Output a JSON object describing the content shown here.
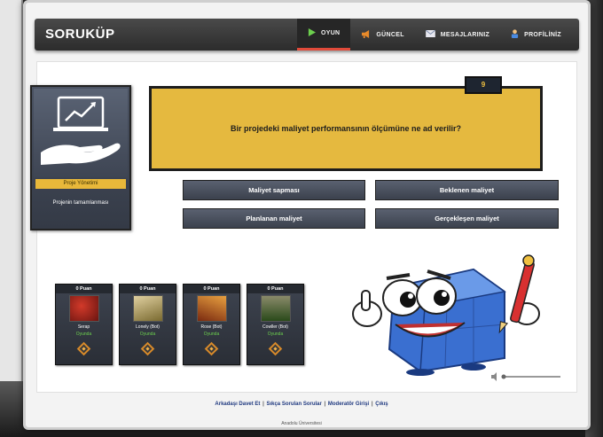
{
  "app": {
    "logo": "SORUKÜP"
  },
  "nav": [
    {
      "label": "OYUN",
      "icon": "play-icon",
      "active": true
    },
    {
      "label": "GÜNCEL",
      "icon": "megaphone-icon",
      "active": false
    },
    {
      "label": "MESAJLARINIZ",
      "icon": "envelope-icon",
      "active": false
    },
    {
      "label": "PROFİLİNİZ",
      "icon": "user-icon",
      "active": false
    }
  ],
  "project": {
    "title": "Proje Yönetimi",
    "subtitle": "Projenin tamamlanması"
  },
  "question": {
    "number": "9",
    "text": "Bir projedeki maliyet performansının ölçümüne ne ad verilir?"
  },
  "answers": [
    "Maliyet sapması",
    "Beklenen maliyet",
    "Planlanan maliyet",
    "Gerçekleşen maliyet"
  ],
  "players": [
    {
      "score": "0 Puan",
      "name": "Serap",
      "status": "Oyunda",
      "avatar_colors": [
        "#8a1a14",
        "#d23a2a"
      ]
    },
    {
      "score": "0 Puan",
      "name": "Lonely (Bot)",
      "status": "Oyunda",
      "avatar_colors": [
        "#c8b070",
        "#7a6a30"
      ]
    },
    {
      "score": "0 Puan",
      "name": "Rose (Bot)",
      "status": "Oyunda",
      "avatar_colors": [
        "#a04a1a",
        "#d9822a"
      ]
    },
    {
      "score": "0 Puan",
      "name": "Cowller (Bot)",
      "status": "Oyunda",
      "avatar_colors": [
        "#3a5a2a",
        "#8a7a4a"
      ]
    }
  ],
  "footer": {
    "links": [
      "Arkadaşı Davet Et",
      "Sıkça Sorulan Sorular",
      "Moderatör Girişi",
      "Çıkış"
    ],
    "copyright": "Anadolu Üniversitesi"
  },
  "colors": {
    "accent": "#e04a3a",
    "question_bg": "#e5b93f",
    "status_green": "#6ccf4e"
  }
}
